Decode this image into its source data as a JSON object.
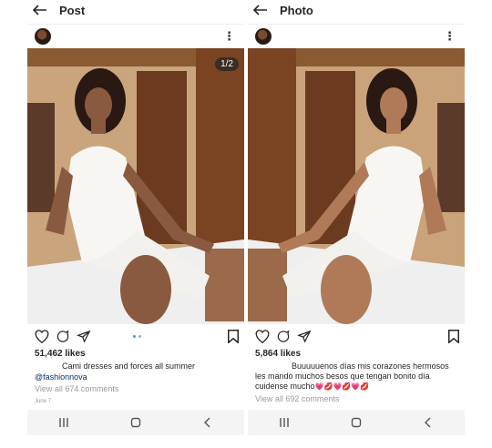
{
  "left": {
    "title": "Post",
    "counter": "1/2",
    "likes": "51,462 likes",
    "caption": "Cami dresses and forces all summer",
    "mention": "@fashionnova",
    "comments": "View all 674 comments",
    "date": "June 7"
  },
  "right": {
    "title": "Photo",
    "likes": "5,864 likes",
    "caption_line1": "Buuuuuenos días mis corazones hermosos",
    "caption_line2": "les mando muchos besos que tengan bonito día",
    "caption_line3": "cuidense mucho",
    "emoji_row": "💗💋💗💋💗💋",
    "comments": "View all 692 comments"
  },
  "colors": {
    "link": "#003569",
    "accent": "#3897f0",
    "muted": "#999999"
  },
  "icons": [
    "back-arrow-icon",
    "more-options-icon",
    "heart-icon",
    "comment-icon",
    "share-icon",
    "bookmark-icon",
    "recent-apps-icon",
    "home-icon",
    "back-nav-icon"
  ]
}
